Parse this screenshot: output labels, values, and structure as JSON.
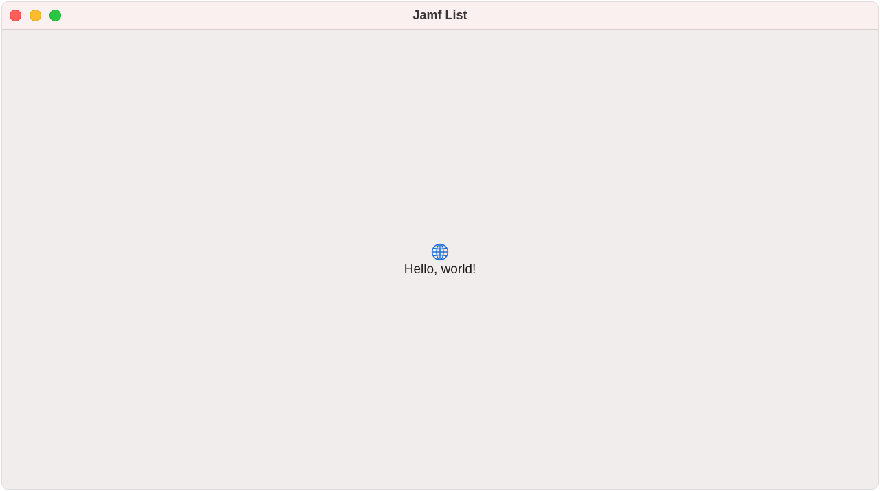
{
  "window": {
    "title": "Jamf List"
  },
  "controls": {
    "close_color": "#fe5f57",
    "minimize_color": "#febc2e",
    "zoom_color": "#28c840"
  },
  "content": {
    "icon": "globe-icon",
    "icon_color": "#1f6fd6",
    "greeting": "Hello, world!"
  }
}
